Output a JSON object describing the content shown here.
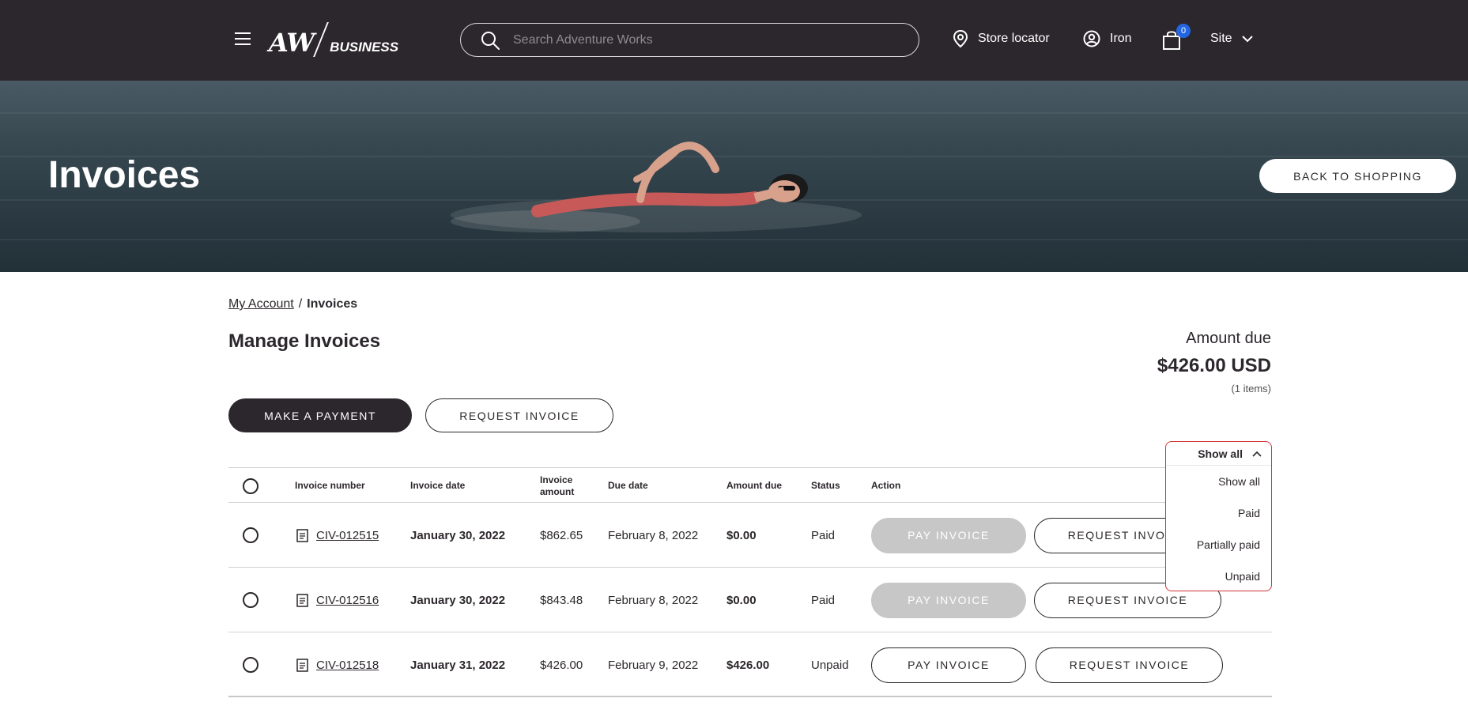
{
  "header": {
    "logo_mark": "AW",
    "logo_text": "BUSINESS",
    "search_placeholder": "Search Adventure Works",
    "store_locator": "Store locator",
    "user": "Iron",
    "cart_count": "0",
    "site": "Site"
  },
  "hero": {
    "title": "Invoices",
    "back_button": "BACK TO SHOPPING"
  },
  "breadcrumb": {
    "parent": "My Account",
    "separator": "/",
    "current": "Invoices"
  },
  "page": {
    "title": "Manage Invoices",
    "amount_label": "Amount due",
    "amount_value": "$426.00 USD",
    "amount_items": "(1 items)",
    "make_payment": "MAKE A PAYMENT",
    "request_invoice": "REQUEST INVOICE"
  },
  "filter": {
    "selected": "Show all",
    "options": [
      "Show all",
      "Paid",
      "Partially paid",
      "Unpaid"
    ]
  },
  "table": {
    "headers": {
      "invoice_number": "Invoice number",
      "invoice_date": "Invoice date",
      "invoice_amount": "Invoice amount",
      "due_date": "Due date",
      "amount_due": "Amount due",
      "status": "Status",
      "action": "Action"
    },
    "rows": [
      {
        "invoice_number": "CIV-012515",
        "invoice_date": "January 30, 2022",
        "invoice_amount": "$862.65",
        "due_date": "February 8, 2022",
        "amount_due": "$0.00",
        "status": "Paid",
        "pay_label": "PAY INVOICE",
        "request_label": "REQUEST INVOICE"
      },
      {
        "invoice_number": "CIV-012516",
        "invoice_date": "January 30, 2022",
        "invoice_amount": "$843.48",
        "due_date": "February 8, 2022",
        "amount_due": "$0.00",
        "status": "Paid",
        "pay_label": "PAY INVOICE",
        "request_label": "REQUEST INVOICE"
      },
      {
        "invoice_number": "CIV-012518",
        "invoice_date": "January 31, 2022",
        "invoice_amount": "$426.00",
        "due_date": "February 9, 2022",
        "amount_due": "$426.00",
        "status": "Unpaid",
        "pay_label": "PAY INVOICE",
        "request_label": "REQUEST INVOICE"
      }
    ]
  },
  "colors": {
    "header_bg": "#2c272c",
    "accent_badge": "#2266e3",
    "dropdown_border": "#d13438",
    "disabled_button": "#c7c7c7"
  },
  "icons": [
    "hamburger-icon",
    "search-icon",
    "location-pin-icon",
    "user-circle-icon",
    "shopping-bag-icon",
    "chevron-down-icon",
    "chevron-up-icon",
    "document-icon"
  ]
}
